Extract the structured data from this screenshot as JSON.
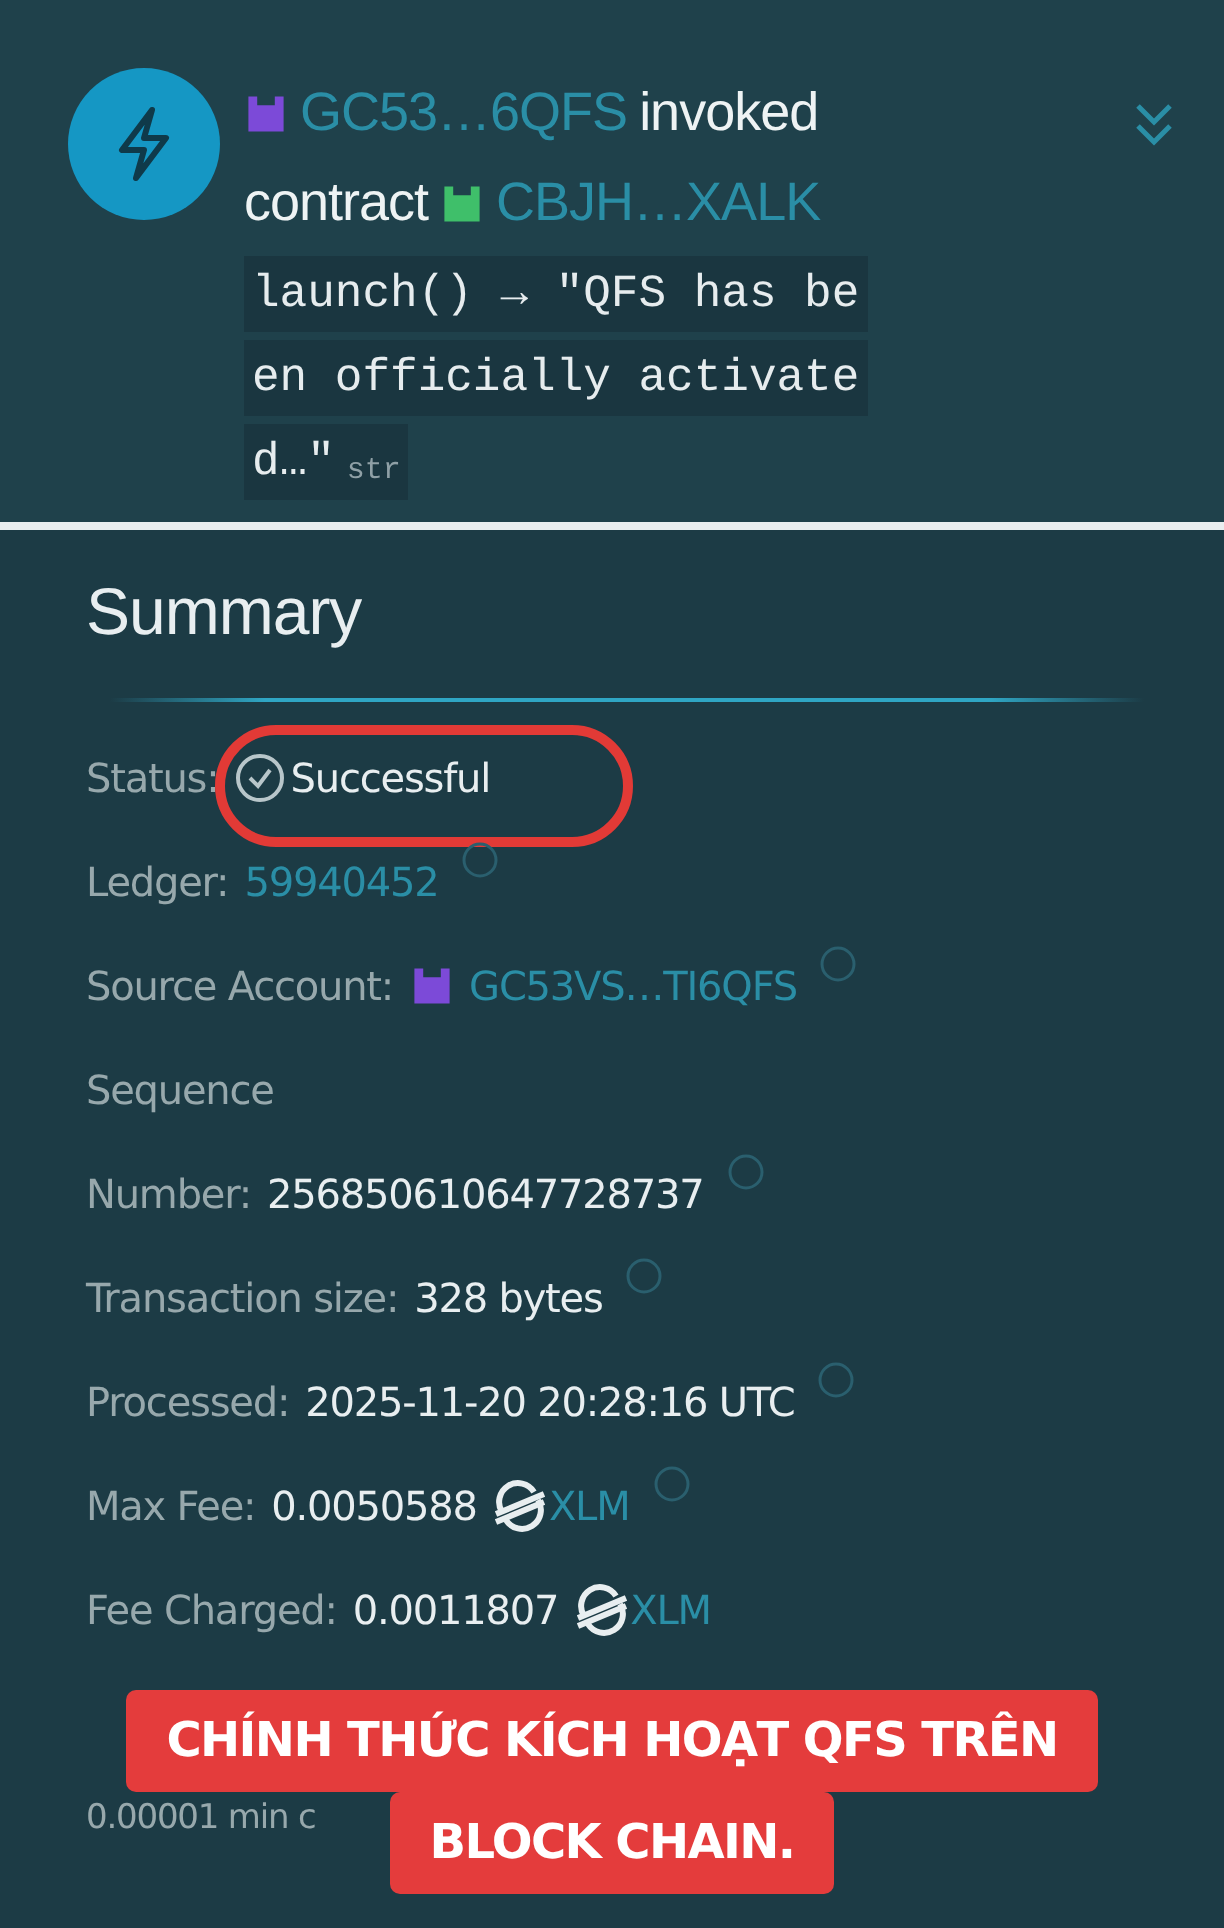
{
  "operation": {
    "source": "GC53…6QFS",
    "verb": "invoked",
    "object_label": "contract",
    "contract": "CBJH…XALK",
    "code_lines": [
      "launch() → \"QFS has be",
      "en officially activate",
      "d…\""
    ],
    "type_tag": "str",
    "expanded": false
  },
  "summary": {
    "title": "Summary",
    "rows": [
      {
        "kind": "status",
        "label": "Status:",
        "value": "Successful",
        "highlighted": true
      },
      {
        "kind": "link",
        "label": "Ledger:",
        "value": "59940452",
        "help": true
      },
      {
        "kind": "account",
        "label": "Source Account:",
        "value": "GC53VS…TI6QFS",
        "help": true
      },
      {
        "kind": "heading",
        "label": "Sequence"
      },
      {
        "kind": "text",
        "label": "Number:",
        "value": "256850610647728737",
        "help": true
      },
      {
        "kind": "text",
        "label": "Transaction size:",
        "value": "328 bytes",
        "help": true
      },
      {
        "kind": "text",
        "label": "Processed:",
        "value": "2025-11-20 20:28:16 UTC",
        "help": true
      },
      {
        "kind": "amount",
        "label": "Max Fee:",
        "value": "0.0050588",
        "asset": "XLM",
        "help": true
      },
      {
        "kind": "amount",
        "label": "Fee Charged:",
        "value": "0.0011807",
        "asset": "XLM",
        "help": false
      },
      {
        "kind": "spacer"
      },
      {
        "kind": "note",
        "label": "0.00001 min c"
      }
    ]
  },
  "caption": {
    "lines": [
      "CHÍNH THỨC KÍCH HOẠT QFS TRÊN",
      "BLOCK CHAIN."
    ]
  }
}
